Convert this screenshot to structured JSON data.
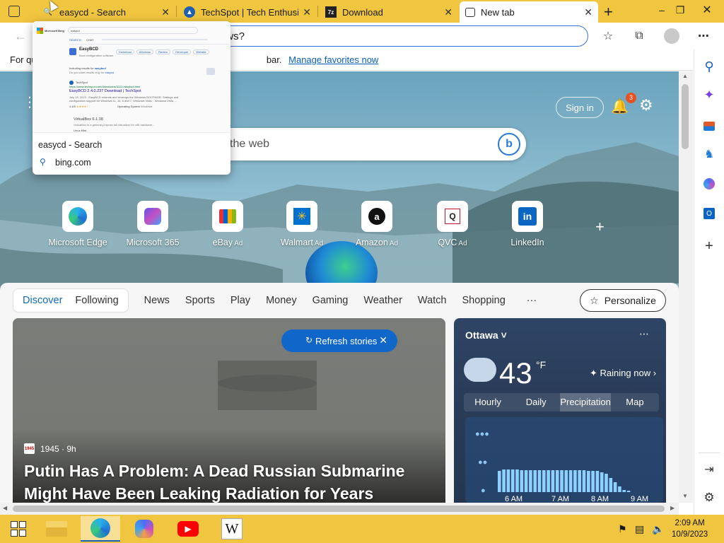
{
  "tabs": [
    {
      "title": "easycd - Search",
      "icon": "bing-search-icon"
    },
    {
      "title": "TechSpot | Tech Enthusiast",
      "icon": "techspot-icon"
    },
    {
      "title": "Download",
      "icon": "7zip-icon"
    },
    {
      "title": "New tab",
      "icon": "newtab-icon"
    }
  ],
  "address_bar": {
    "value": "ows?"
  },
  "favorites_bar": {
    "prefix": "For qu",
    "middle": "bar.",
    "link": "Manage favorites now"
  },
  "preview": {
    "title": "easycd - Search",
    "url": "bing.com",
    "thumb": {
      "logo": "Microsoft Bing",
      "query": "easycd",
      "tabs": [
        "SEARCH",
        "CHAT"
      ],
      "result_name": "EasyBCD",
      "result_sub": "Boot configuration software",
      "chips": [
        "Download",
        "Windows",
        "Review",
        "Developer",
        "Website"
      ],
      "including": "Including results for",
      "including_term": "easybcd",
      "only_prefix": "Do you want results only for",
      "only_term": "easycd",
      "site_name": "TechSpot",
      "result_url": "https://www.techspot.com/downloads/3112-easybcd.html",
      "result_title": "EasyBCD 2.4.0.237 Download | TechSpot",
      "result_snip1": "July 19, 2023 · EasyBCD extends and revamps the Windows BOOTMGR. Settings and",
      "result_snip2": "configuration support for Windows 11, 10, 8 and 7, Windows Vista... Windows Vista, ...",
      "rating": "4.4/5",
      "system_label": "Operating System",
      "system_value": "Windows",
      "second_title": "VirtualBox 6.1.38",
      "second_snip": "VirtualBox is a general-purpose full virtualizer for x86 hardware...",
      "third_title": "Linux Mint"
    }
  },
  "ntp": {
    "search_placeholder": "the web",
    "sign_in": "Sign in",
    "notification_count": "3",
    "quick_links": [
      {
        "label": "Microsoft Edge",
        "ad": "",
        "icon": "edge-icon"
      },
      {
        "label": "Microsoft 365",
        "ad": "",
        "icon": "m365-icon"
      },
      {
        "label": "eBay",
        "ad": "Ad",
        "icon": "ebay-icon"
      },
      {
        "label": "Walmart",
        "ad": "Ad",
        "icon": "walmart-icon"
      },
      {
        "label": "Amazon",
        "ad": "Ad",
        "icon": "amazon-icon"
      },
      {
        "label": "QVC",
        "ad": "Ad",
        "icon": "qvc-icon"
      },
      {
        "label": "LinkedIn",
        "ad": "",
        "icon": "linkedin-icon"
      }
    ]
  },
  "feed": {
    "pill": [
      "Discover",
      "Following"
    ],
    "nav": [
      "News",
      "Sports",
      "Play",
      "Money",
      "Gaming",
      "Weather",
      "Watch",
      "Shopping"
    ],
    "more": "···",
    "personalize": "Personalize",
    "refresh": "Refresh stories",
    "hero": {
      "source": "1945 · 9h",
      "logo_text": "1945",
      "title": "Putin Has A Problem: A Dead Russian Submarine Might Have Been Leaking Radiation for Years"
    },
    "weather": {
      "city": "Ottawa",
      "temp": "43",
      "unit": "°F",
      "condition": "Raining now",
      "tabs": [
        "Hourly",
        "Daily",
        "Precipitation",
        "Map"
      ],
      "active_tab": "Precipitation",
      "times": [
        "6 AM",
        "7 AM",
        "8 AM",
        "9 AM"
      ]
    }
  },
  "taskbar": {
    "time": "2:09 AM",
    "date": "10/9/2023"
  },
  "colors": {
    "accent": "#f0c53f",
    "edge_blue": "#1167c9"
  }
}
